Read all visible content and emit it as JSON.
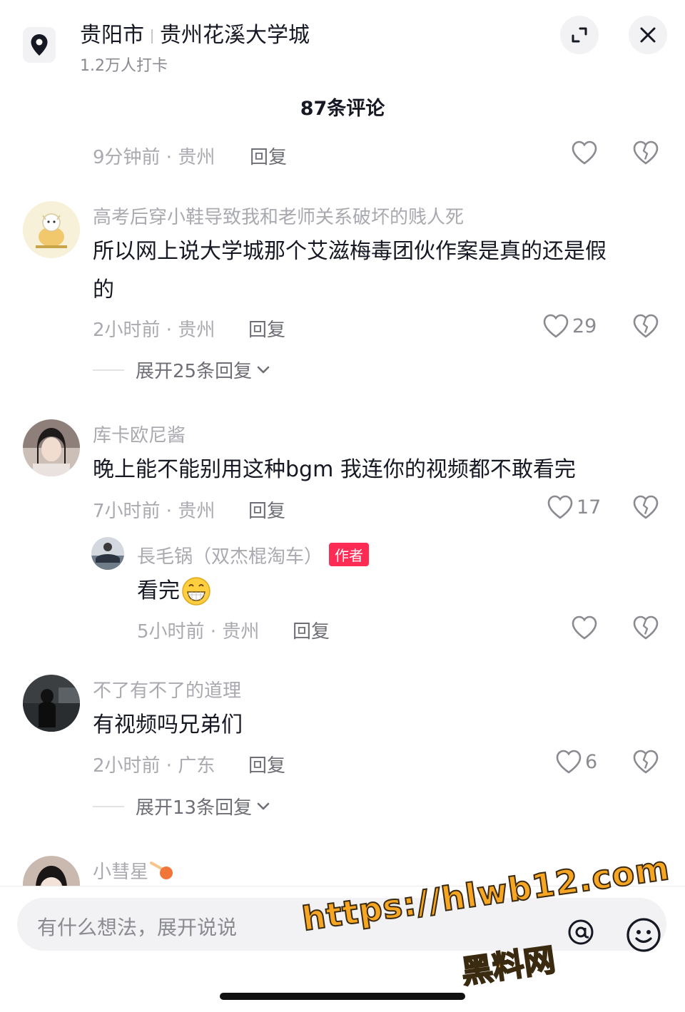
{
  "header": {
    "city": "贵阳市",
    "place": "贵州花溪大学城",
    "checkins": "1.2万人打卡",
    "icons": {
      "pin": "location-pin-icon",
      "expand": "expand-icon",
      "close": "close-icon"
    }
  },
  "comments_count": "87条评论",
  "first_meta": {
    "time": "9分钟前 · 贵州",
    "reply": "回复"
  },
  "comments": [
    {
      "user": "高考后穿小鞋导致我和老师关系破坏的贱人死",
      "text_line1": "所以网上说大学城那个艾滋梅毒团伙作案是真的还是假",
      "text_line2": "的",
      "time": "2小时前 · 贵州",
      "reply": "回复",
      "likes": "29",
      "expand": "展开25条回复"
    },
    {
      "user": "库卡欧尼酱",
      "text": "晚上能不能别用这种bgm 我连你的视频都不敢看完",
      "time": "7小时前 · 贵州",
      "reply": "回复",
      "likes": "17",
      "sub_reply": {
        "user": "長毛锅（双杰棍淘车）",
        "badge": "作者",
        "text": "看完",
        "emoji": "😁",
        "time": "5小时前 · 贵州",
        "reply": "回复"
      }
    },
    {
      "user": "不了有不了的道理",
      "text": "有视频吗兄弟们",
      "time": "2小时前 · 广东",
      "reply": "回复",
      "likes": "6",
      "expand": "展开13条回复"
    },
    {
      "user": "小彗星"
    }
  ],
  "input": {
    "placeholder": "有什么想法，展开说说"
  },
  "watermark": {
    "url": "https://hlwb12.com",
    "name": "黑料网"
  },
  "colors": {
    "accent": "#fe2c55",
    "watermark": "#f6a623"
  }
}
